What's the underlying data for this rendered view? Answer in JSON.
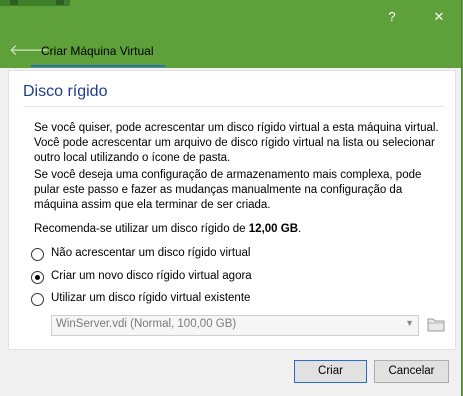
{
  "window": {
    "help_label": "?",
    "close_label": "✕"
  },
  "nav": {
    "title": "Criar Máquina Virtual",
    "back_glyph": "🡐"
  },
  "page": {
    "title": "Disco rígido",
    "paragraph1": "Se você quiser, pode acrescentar um disco rígido virtual a esta máquina virtual. Você pode acrescentar um arquivo de disco rígido virtual na lista ou selecionar outro local utilizando o ícone de pasta.",
    "paragraph2": "Se você deseja uma configuração de armazenamento mais complexa, pode pular este passo e fazer as mudanças manualmente na configuração da máquina assim que ela terminar de ser criada.",
    "recommend_prefix": "Recomenda-se utilizar um disco rígido de ",
    "recommend_size": "12,00 GB",
    "recommend_suffix": "."
  },
  "options": [
    {
      "label": "Não acrescentar um disco rígido virtual",
      "checked": false
    },
    {
      "label": "Criar um novo disco rígido virtual agora",
      "checked": true
    },
    {
      "label": "Utilizar um disco rígido virtual existente",
      "checked": false
    }
  ],
  "existing_disk": {
    "selected": "WinServer.vdi (Normal, 100,00 GB)"
  },
  "icons": {
    "folder": "folder-icon",
    "dropdown": "chevron-down-icon",
    "back": "back-arrow-icon"
  },
  "buttons": {
    "create": "Criar",
    "cancel": "Cancelar"
  },
  "colors": {
    "header_green": "#5ea13a",
    "title_blue": "#1e3d8c",
    "accent_blue": "#2a6bc4"
  }
}
